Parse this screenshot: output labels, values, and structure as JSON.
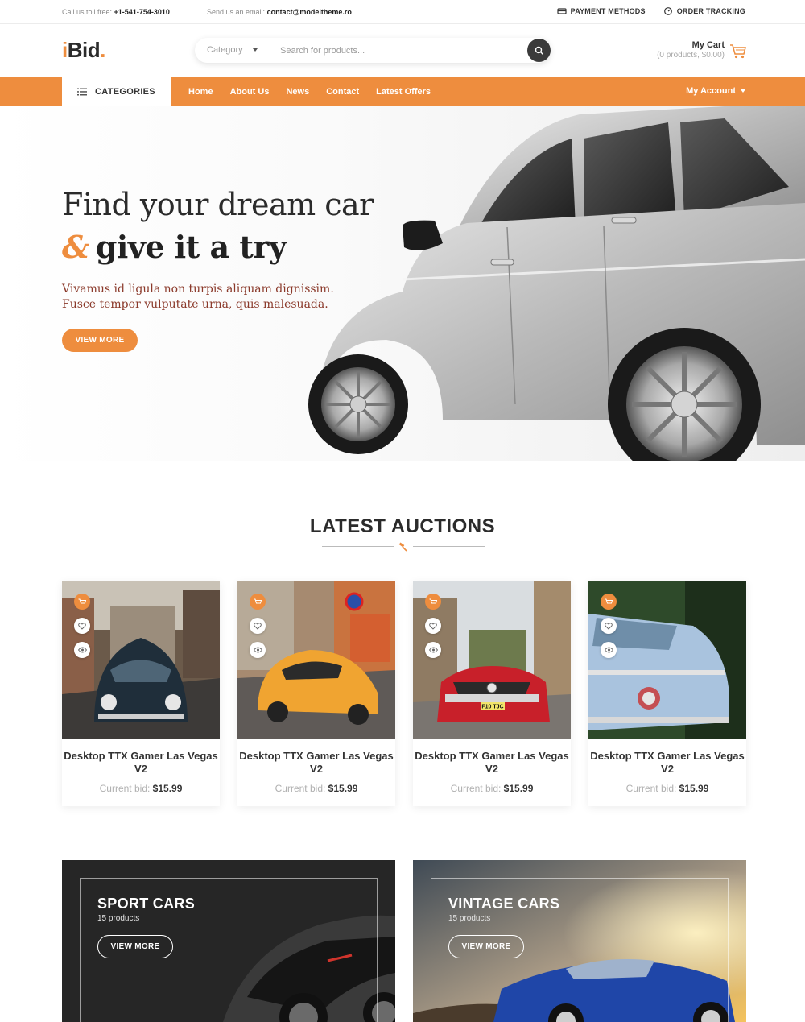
{
  "topbar": {
    "phone_label": "Call us toll free:",
    "phone": "+1-541-754-3010",
    "email_label": "Send us an email:",
    "email": "contact@modeltheme.ro",
    "payment": "PAYMENT METHODS",
    "tracking": "ORDER TRACKING"
  },
  "header": {
    "logo_i": "i",
    "logo_rest": "Bid",
    "logo_dot": ".",
    "category": "Category",
    "search_placeholder": "Search for products...",
    "cart_title": "My Cart",
    "cart_summary": "(0 products, $0.00)"
  },
  "nav": {
    "categories": "CATEGORIES",
    "links": [
      "Home",
      "About Us",
      "News",
      "Contact",
      "Latest Offers"
    ],
    "account": "My Account"
  },
  "hero": {
    "line1": "Find your dream car",
    "amp": "&",
    "line2": "give it a try",
    "text": "Vivamus id ligula non turpis aliquam dignissim. Fusce tempor vulputate urna, quis malesuada.",
    "button": "VIEW MORE"
  },
  "auctions": {
    "title": "LATEST AUCTIONS",
    "items": [
      {
        "name": "Desktop TTX Gamer Las Vegas V2",
        "bid_label": "Current bid:",
        "price": "$15.99"
      },
      {
        "name": "Desktop TTX Gamer Las Vegas V2",
        "bid_label": "Current bid:",
        "price": "$15.99"
      },
      {
        "name": "Desktop TTX Gamer Las Vegas V2",
        "bid_label": "Current bid:",
        "price": "$15.99",
        "plate": "F10 TJC"
      },
      {
        "name": "Desktop TTX Gamer Las Vegas V2",
        "bid_label": "Current bid:",
        "price": "$15.99"
      }
    ]
  },
  "promos": [
    {
      "title": "SPORT CARS",
      "count": "15 products",
      "button": "VIEW MORE"
    },
    {
      "title": "VINTAGE CARS",
      "count": "15 products",
      "button": "VIEW MORE"
    }
  ],
  "colors": {
    "accent": "#ee8d3e",
    "dark": "#2b2b2b"
  }
}
